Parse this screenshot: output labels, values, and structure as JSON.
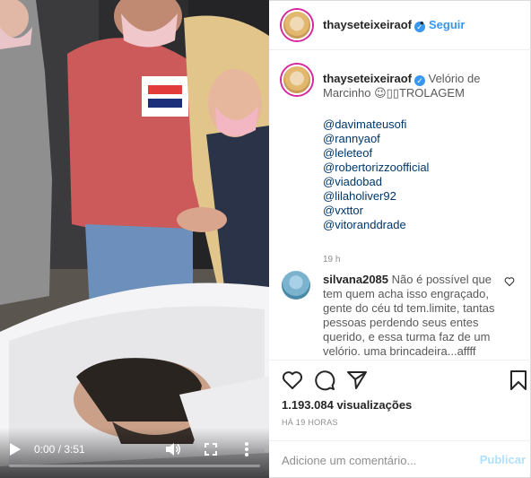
{
  "video": {
    "time": "0:00 / 3:51",
    "progress": 0,
    "icons": [
      "play-icon",
      "volume-icon",
      "fullscreen-icon",
      "more-options-icon"
    ]
  },
  "header": {
    "username": "thayseteixeiraof",
    "verified_mark": "✓",
    "separator": "•",
    "follow_label": "Seguir"
  },
  "caption": {
    "username": "thayseteixeiraof",
    "text": "Velório de Marcinho 😉▯▯TROLAGEM",
    "mentions": [
      "@davimateusofi",
      "@rannyaof",
      "@leleteof",
      "@robertorizzoofficial",
      "@viadobad",
      "@lilaholiver92",
      "@vxttor",
      "@vitoranddrade"
    ],
    "time": "19 h"
  },
  "comment": {
    "username": "silvana2085",
    "text": "Não é possível que tem quem acha isso engraçado, gente do céu td tem.limite, tantas pessoas perdendo seus entes querido, e essa turma faz de um velório. uma brincadeira...affff"
  },
  "actions": {
    "icons": [
      "heart-icon",
      "comment-icon",
      "share-icon",
      "bookmark-icon"
    ],
    "views": "1.193.084 visualizações",
    "ago": "HÁ 19 HORAS"
  },
  "comment_box": {
    "placeholder": "Adicione um comentário...",
    "publish_label": "Publicar"
  },
  "colors": {
    "link_blue": "#3897f0",
    "mention_blue": "#00376b",
    "muted": "#8e8e8e",
    "publish_disabled": "#b2dffc"
  }
}
